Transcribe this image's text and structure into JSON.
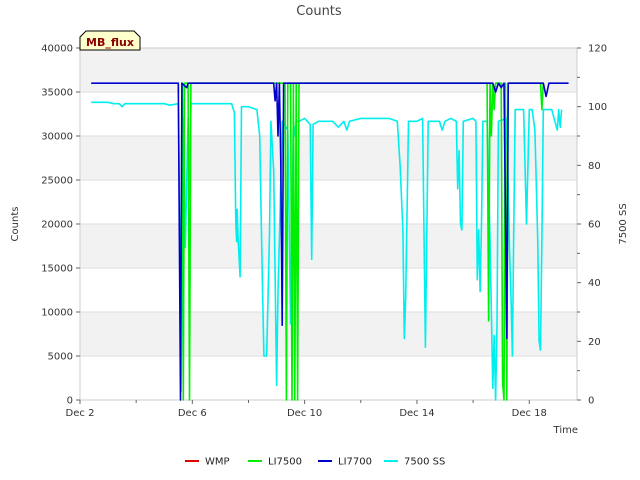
{
  "chart_data": {
    "type": "line",
    "title": "Counts",
    "badge": "MB_flux",
    "xlabel": "Time",
    "ylabel": "Counts",
    "y2label": "7500 SS",
    "x_ticks": [
      "Dec 2",
      "Dec 6",
      "Dec 10",
      "Dec 14",
      "Dec 18"
    ],
    "x_tick_days": [
      2,
      6,
      10,
      14,
      18
    ],
    "xlim": [
      2,
      19.7
    ],
    "ylim": [
      0,
      40000
    ],
    "y_ticks": [
      0,
      5000,
      10000,
      15000,
      20000,
      25000,
      30000,
      35000,
      40000
    ],
    "y2lim": [
      0,
      120
    ],
    "y2_ticks": [
      0,
      20,
      40,
      60,
      80,
      100,
      120
    ],
    "grid": true,
    "legend_position": "bottom",
    "series": [
      {
        "name": "WMP",
        "color": "#dd0000",
        "axis": "left",
        "points": []
      },
      {
        "name": "LI7500",
        "color": "#00ee00",
        "axis": "left",
        "points": [
          [
            5.6,
            36000
          ],
          [
            5.65,
            36000
          ],
          [
            5.68,
            0
          ],
          [
            5.72,
            36000
          ],
          [
            5.85,
            36000
          ],
          [
            5.9,
            0
          ],
          [
            5.95,
            36000
          ],
          [
            9.3,
            36000
          ],
          [
            9.35,
            0
          ],
          [
            9.4,
            36000
          ],
          [
            9.5,
            36000
          ],
          [
            9.55,
            0
          ],
          [
            9.6,
            36000
          ],
          [
            9.65,
            0
          ],
          [
            9.7,
            36000
          ],
          [
            9.75,
            0
          ],
          [
            9.8,
            36000
          ],
          [
            16.5,
            36000
          ],
          [
            16.55,
            9000
          ],
          [
            16.6,
            36000
          ],
          [
            16.65,
            30000
          ],
          [
            16.7,
            36000
          ],
          [
            16.75,
            33000
          ],
          [
            16.8,
            36000
          ],
          [
            17.0,
            36000
          ],
          [
            17.05,
            2000
          ],
          [
            17.1,
            0
          ],
          [
            17.15,
            36000
          ],
          [
            17.2,
            0
          ],
          [
            17.25,
            36000
          ],
          [
            18.4,
            36000
          ],
          [
            18.45,
            33000
          ],
          [
            18.5,
            36000
          ]
        ]
      },
      {
        "name": "LI7700",
        "color": "#0000cc",
        "axis": "left",
        "points": [
          [
            2.4,
            36000
          ],
          [
            5.5,
            36000
          ],
          [
            5.58,
            0
          ],
          [
            5.63,
            36000
          ],
          [
            5.8,
            35500
          ],
          [
            5.85,
            36000
          ],
          [
            8.9,
            36000
          ],
          [
            8.95,
            34000
          ],
          [
            9.0,
            36000
          ],
          [
            9.05,
            30000
          ],
          [
            9.1,
            36000
          ],
          [
            9.15,
            27000
          ],
          [
            9.2,
            8500
          ],
          [
            9.25,
            36000
          ],
          [
            14.0,
            36000
          ],
          [
            16.7,
            36000
          ],
          [
            16.8,
            35000
          ],
          [
            16.9,
            36000
          ],
          [
            17.0,
            35500
          ],
          [
            17.1,
            36000
          ],
          [
            17.2,
            7000
          ],
          [
            17.25,
            36000
          ],
          [
            18.5,
            36000
          ],
          [
            18.6,
            34500
          ],
          [
            18.7,
            36000
          ],
          [
            19.4,
            36000
          ]
        ]
      },
      {
        "name": "7500 SS",
        "color": "#00eeee",
        "axis": "right",
        "points": [
          [
            2.4,
            101.5
          ],
          [
            3.0,
            101.5
          ],
          [
            3.2,
            101
          ],
          [
            3.4,
            101
          ],
          [
            3.5,
            100
          ],
          [
            3.6,
            101
          ],
          [
            4.4,
            101
          ],
          [
            4.6,
            101
          ],
          [
            5.0,
            101
          ],
          [
            5.2,
            100.5
          ],
          [
            5.5,
            101
          ],
          [
            5.55,
            60
          ],
          [
            5.6,
            3
          ],
          [
            5.63,
            40
          ],
          [
            5.68,
            96
          ],
          [
            5.75,
            52
          ],
          [
            5.85,
            96
          ],
          [
            5.9,
            68
          ],
          [
            5.95,
            101
          ],
          [
            7.4,
            101
          ],
          [
            7.5,
            98
          ],
          [
            7.55,
            60
          ],
          [
            7.58,
            54
          ],
          [
            7.6,
            65
          ],
          [
            7.63,
            55
          ],
          [
            7.7,
            42
          ],
          [
            7.75,
            100
          ],
          [
            8.0,
            100
          ],
          [
            8.3,
            99
          ],
          [
            8.4,
            90
          ],
          [
            8.5,
            38
          ],
          [
            8.55,
            15
          ],
          [
            8.65,
            15
          ],
          [
            8.75,
            57
          ],
          [
            8.8,
            95
          ],
          [
            8.9,
            78
          ],
          [
            9.0,
            5
          ],
          [
            9.05,
            37
          ],
          [
            9.1,
            55
          ],
          [
            9.2,
            95
          ],
          [
            9.4,
            92
          ],
          [
            9.5,
            26
          ],
          [
            9.55,
            60
          ],
          [
            9.6,
            95
          ],
          [
            9.65,
            90
          ],
          [
            9.7,
            95
          ],
          [
            9.8,
            95
          ],
          [
            10.0,
            96
          ],
          [
            10.2,
            94
          ],
          [
            10.25,
            48
          ],
          [
            10.3,
            94
          ],
          [
            10.5,
            95
          ],
          [
            11.0,
            95
          ],
          [
            11.2,
            93
          ],
          [
            11.4,
            95
          ],
          [
            11.5,
            92
          ],
          [
            11.6,
            95
          ],
          [
            12.0,
            96
          ],
          [
            12.5,
            96
          ],
          [
            13.0,
            96
          ],
          [
            13.3,
            95
          ],
          [
            13.4,
            80
          ],
          [
            13.5,
            58
          ],
          [
            13.55,
            21
          ],
          [
            13.6,
            35
          ],
          [
            13.7,
            95
          ],
          [
            14.0,
            95
          ],
          [
            14.2,
            96
          ],
          [
            14.3,
            18
          ],
          [
            14.4,
            95
          ],
          [
            14.8,
            95
          ],
          [
            14.9,
            92
          ],
          [
            15.0,
            95
          ],
          [
            15.2,
            96
          ],
          [
            15.4,
            95
          ],
          [
            15.45,
            72
          ],
          [
            15.5,
            85
          ],
          [
            15.55,
            60
          ],
          [
            15.6,
            58
          ],
          [
            15.65,
            95
          ],
          [
            16.0,
            96
          ],
          [
            16.1,
            95
          ],
          [
            16.15,
            41
          ],
          [
            16.2,
            58
          ],
          [
            16.25,
            37
          ],
          [
            16.3,
            60
          ],
          [
            16.35,
            95
          ],
          [
            16.5,
            95
          ],
          [
            16.6,
            55
          ],
          [
            16.7,
            4
          ],
          [
            16.75,
            22
          ],
          [
            16.8,
            0
          ],
          [
            16.85,
            25
          ],
          [
            16.9,
            95
          ],
          [
            17.2,
            96
          ],
          [
            17.3,
            50
          ],
          [
            17.35,
            35
          ],
          [
            17.4,
            15
          ],
          [
            17.45,
            60
          ],
          [
            17.5,
            99
          ],
          [
            17.8,
            99
          ],
          [
            17.9,
            60
          ],
          [
            18.0,
            99
          ],
          [
            18.1,
            99
          ],
          [
            18.2,
            92
          ],
          [
            18.3,
            55
          ],
          [
            18.35,
            20
          ],
          [
            18.4,
            17
          ],
          [
            18.45,
            55
          ],
          [
            18.5,
            99
          ],
          [
            18.7,
            99
          ],
          [
            18.8,
            99
          ],
          [
            19.0,
            92
          ],
          [
            19.05,
            99
          ],
          [
            19.1,
            93
          ],
          [
            19.15,
            99
          ]
        ]
      }
    ]
  }
}
